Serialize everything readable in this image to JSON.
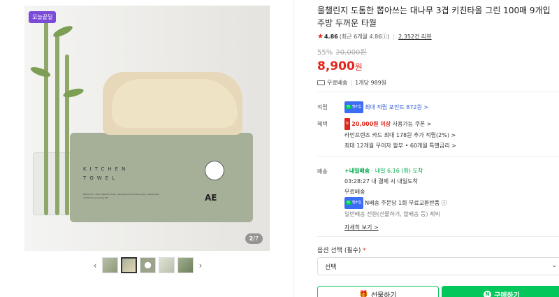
{
  "gallery": {
    "badge": "오늘끝딜",
    "counter_current": "2",
    "counter_total": "/7",
    "box_text_1": "KITCHEN",
    "box_text_2": "TOWEL",
    "box_small_text": "Made from 100% Bamboo Pulp, naturally soft and strong for sustainable comfort in everyday life.",
    "box_logo_text": "AE"
  },
  "product": {
    "title": "울챌린지 도톰한 뽑아쓰는 대나무 3겹 키친타올 그린 100매 9개입 주방 두꺼운 타월",
    "rating": "4.86",
    "rating_detail": "(최근 6개월 4.86",
    "rating_info_icon": "ⓘ",
    "rating_close": ")",
    "review_count": "2,352건 리뷰",
    "discount": "55%",
    "original_price": "20,000원",
    "price": "8,900",
    "price_unit": "원",
    "shipping": "무료배송",
    "unit_price": "1개당 989원"
  },
  "points": {
    "label": "적립",
    "badge": "멤버십",
    "text": "최대 적립 포인트 872원 >"
  },
  "benefits": {
    "label": "혜택",
    "line1_prefix": "20,000원 이상",
    "line1_suffix": "사용가능 쿠폰 >",
    "line2": "라인프렌즈 카드 최대 178원 추가 적립(2%) >",
    "line3": "최대 12개월 무이자 할부 • 60개월 특별금리 >"
  },
  "delivery": {
    "label": "배송",
    "tag": "내일배송",
    "date": "· 내일 6.16 (화) 도착",
    "line2": "03:28:27  내 결제 시 내일도착",
    "line3": "무료배송",
    "line4": "N배송 주문당 1회 무료교환반품 ⓘ",
    "line5": "일반배송 전환(선물하기, 합배송 등) 제외",
    "more": "자세히 보기 >"
  },
  "option": {
    "label": "옵션 선택 (필수)",
    "required_mark": "*",
    "select_value": "선택"
  },
  "buttons": {
    "gift": "선물하기",
    "buy": "구매하기"
  },
  "colors": {
    "accent_red": "#e1261c",
    "naver_green": "#03c75a",
    "link_blue": "#2756d6"
  }
}
